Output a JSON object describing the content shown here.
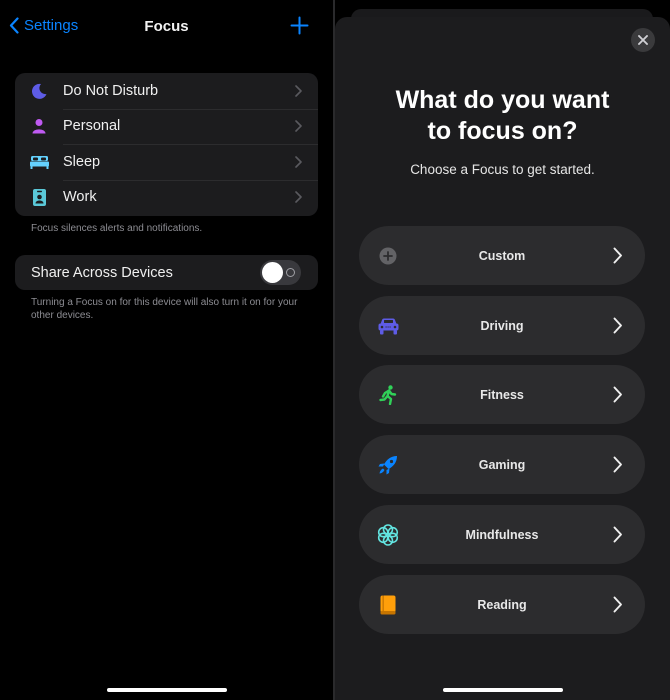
{
  "left": {
    "navbar": {
      "back_label": "Settings",
      "title": "Focus",
      "add_icon": "plus-icon"
    },
    "focus_list": [
      {
        "label": "Do Not Disturb",
        "icon": "moon-icon",
        "color": "#5e5ce6"
      },
      {
        "label": "Personal",
        "icon": "person-icon",
        "color": "#bf5af2"
      },
      {
        "label": "Sleep",
        "icon": "bed-icon",
        "color": "#64d2ff"
      },
      {
        "label": "Work",
        "icon": "id-badge-icon",
        "color": "#5ac8d8"
      }
    ],
    "focus_footnote": "Focus silences alerts and notifications.",
    "share": {
      "label": "Share Across Devices",
      "enabled": false,
      "footnote": "Turning a Focus on for this device will also turn it on for your other devices."
    }
  },
  "right": {
    "close_icon": "close-icon",
    "title_line1": "What do you want",
    "title_line2": "to focus on?",
    "subtitle": "Choose a Focus to get started.",
    "options": [
      {
        "label": "Custom",
        "icon": "plus-circle-icon",
        "color": "#636366"
      },
      {
        "label": "Driving",
        "icon": "car-icon",
        "color": "#5e5ce6"
      },
      {
        "label": "Fitness",
        "icon": "running-icon",
        "color": "#30d158"
      },
      {
        "label": "Gaming",
        "icon": "rocket-icon",
        "color": "#0a84ff"
      },
      {
        "label": "Mindfulness",
        "icon": "flower-icon",
        "color": "#63e6e2"
      },
      {
        "label": "Reading",
        "icon": "book-icon",
        "color": "#ff9f0a"
      }
    ]
  },
  "colors": {
    "accent": "#0a84ff",
    "background": "#000000",
    "grouped_cell": "#1c1c1e",
    "option_pill": "#2c2c2e"
  }
}
